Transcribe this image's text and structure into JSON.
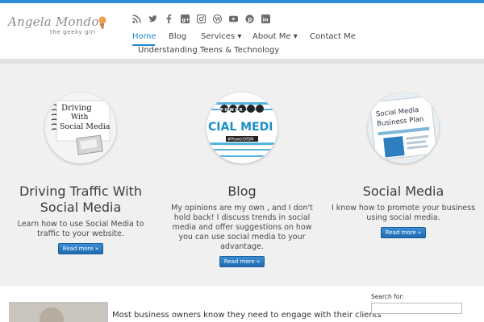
{
  "brand": {
    "name": "Angela Mondor",
    "tagline": "the geeky girl"
  },
  "social_icons": [
    "rss-icon",
    "twitter-icon",
    "facebook-icon",
    "google-plus-icon",
    "instagram-icon",
    "wordpress-icon",
    "youtube-icon",
    "pinterest-icon",
    "linkedin-icon"
  ],
  "nav": {
    "items": [
      {
        "label": "Home",
        "active": true
      },
      {
        "label": "Blog"
      },
      {
        "label": "Services ▾"
      },
      {
        "label": "About Me ▾"
      },
      {
        "label": "Contact Me"
      },
      {
        "label": "Understanding Teens & Technology"
      }
    ]
  },
  "features": [
    {
      "image_text": "Driving With Social Media",
      "title_line1": "Driving Traffic With",
      "title_line2": "Social Media",
      "text": "Learn how to use Social Media to traffic to your website.",
      "button": "Read more »"
    },
    {
      "image_text_top": "POWER OF",
      "image_text_main": "SOCIAL MEDIA",
      "image_hashtag": "#PowerOfSM",
      "title": "Blog",
      "text": "My opinions are my own , and I don't hold back! I discuss trends in social media and offer suggestions on how you can use social media to your advantage.",
      "button": "Read more »"
    },
    {
      "image_text": "Social Media Business Plan",
      "title": "Social Media",
      "text": "I know how to promote your business using social media.",
      "button": "Read more »"
    }
  ],
  "lower": {
    "intro_text": "Most business owners know they need to engage with their clients",
    "search_label": "Search for:",
    "search_placeholder": ""
  },
  "colors": {
    "accent": "#1e86d4",
    "button": "#2a7cc4",
    "background": "#f0f0f0"
  }
}
